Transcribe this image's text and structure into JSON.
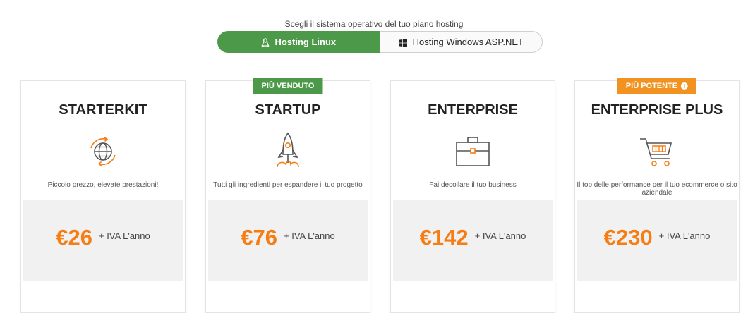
{
  "os_selector": {
    "title": "Scegli il sistema operativo del tuo piano hosting",
    "tabs": [
      {
        "label": "Hosting Linux",
        "icon": "linux-penguin-icon",
        "active": true
      },
      {
        "label": "Hosting Windows ASP.NET",
        "icon": "windows-logo-icon",
        "active": false
      }
    ]
  },
  "colors": {
    "accent_green": "#4c9a49",
    "accent_orange": "#f57d14",
    "icon_grey": "#666666"
  },
  "plans": [
    {
      "name": "STARTERKIT",
      "badge": "",
      "icon": "globe-cycle-icon",
      "description": "Piccolo prezzo, elevate prestazioni!",
      "price": "€26",
      "period": "+ IVA L'anno"
    },
    {
      "name": "STARTUP",
      "badge": "PIÙ VENDUTO",
      "badge_color": "#4c9a49",
      "icon": "rocket-icon",
      "description": "Tutti gli ingredienti per espandere il tuo progetto",
      "price": "€76",
      "period": "+ IVA L'anno"
    },
    {
      "name": "ENTERPRISE",
      "badge": "",
      "icon": "briefcase-icon",
      "description": "Fai decollare il tuo business",
      "price": "€142",
      "period": "+ IVA L'anno"
    },
    {
      "name": "ENTERPRISE PLUS",
      "badge": "PIÙ POTENTE",
      "badge_color": "#f29220",
      "badge_icon": "info-circle-icon",
      "icon": "shopping-cart-icon",
      "description": "Il top delle performance per il tuo ecommerce o sito aziendale",
      "price": "€230",
      "period": "+ IVA L'anno"
    }
  ]
}
